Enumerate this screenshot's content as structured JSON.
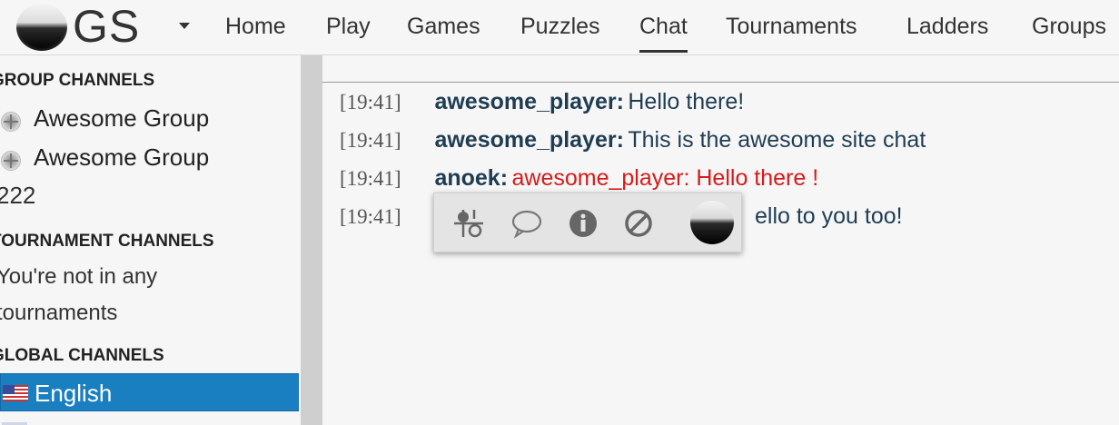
{
  "header": {
    "logo_text": "GS",
    "nav": [
      "Home",
      "Play",
      "Games",
      "Puzzles",
      "Chat",
      "Tournaments",
      "Ladders",
      "Groups"
    ],
    "active_nav": "Chat"
  },
  "sidebar": {
    "group_header": "GROUP CHANNELS",
    "groups": [
      "Awesome Group",
      "Awesome Group"
    ],
    "group_suffix": "222",
    "tournament_header": "TOURNAMENT CHANNELS",
    "tournament_empty_1": "You're not in any",
    "tournament_empty_2": "tournaments",
    "global_header": "GLOBAL CHANNELS",
    "global_selected": "English"
  },
  "chat": {
    "messages": [
      {
        "time": "[19:41]",
        "user": "awesome_player:",
        "text": "Hello there!",
        "highlight": false
      },
      {
        "time": "[19:41]",
        "user": "awesome_player:",
        "text": "This is the awesome site chat",
        "highlight": false
      },
      {
        "time": "[19:41]",
        "user": "anoek:",
        "text": "awesome_player: Hello there !",
        "highlight": true
      },
      {
        "time": "[19:41]",
        "user": "",
        "text": "ello to you too!",
        "highlight": false
      }
    ]
  },
  "popup": {
    "icons": [
      "challenge-icon",
      "message-icon",
      "info-icon",
      "block-icon"
    ]
  },
  "colors": {
    "accent": "#1a7fc1",
    "username": "#1f3d52",
    "highlight": "#d41c1c"
  }
}
